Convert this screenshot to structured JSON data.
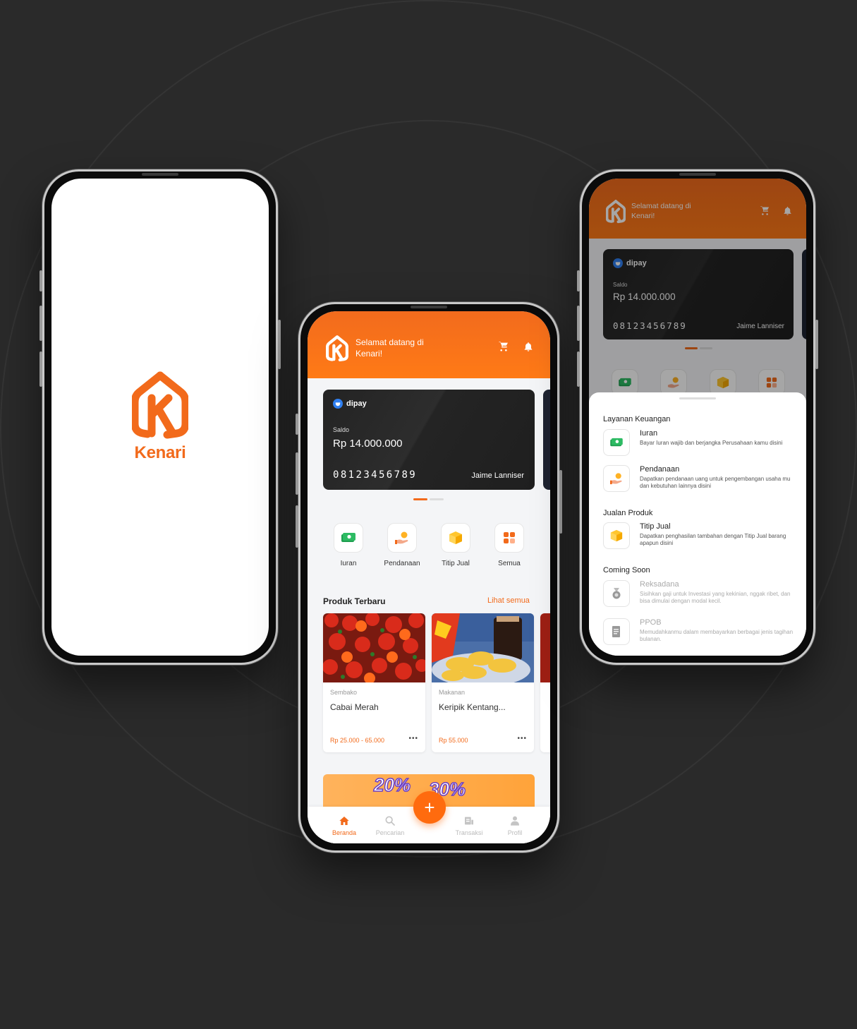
{
  "brand": {
    "name": "Kenari",
    "accent": "#F26A1B"
  },
  "header": {
    "welcome": "Selamat datang di Kenari!",
    "icons": [
      "cart-icon",
      "bell-icon"
    ]
  },
  "wallet": {
    "provider": "dipay",
    "saldo_label": "Saldo",
    "saldo_value": "Rp 14.000.000",
    "card_number": "08123456789",
    "holder": "Jaime Lanniser"
  },
  "menu": [
    {
      "label": "Iuran",
      "icon": "money-icon"
    },
    {
      "label": "Pendanaan",
      "icon": "funding-icon"
    },
    {
      "label": "Titip Jual",
      "icon": "box-icon"
    },
    {
      "label": "Semua",
      "icon": "grid-icon"
    }
  ],
  "products_section": {
    "title": "Produk Terbaru",
    "see_all": "Lihat semua"
  },
  "products": [
    {
      "category": "Sembako",
      "name": "Cabai Merah",
      "price": "Rp 25.000 - 65.000"
    },
    {
      "category": "Makanan",
      "name": "Keripik Kentang...",
      "price": "Rp 55.000"
    }
  ],
  "promo": {
    "texts": [
      "20%",
      "30%"
    ]
  },
  "bottom_nav": [
    {
      "label": "Beranda",
      "icon": "home-icon",
      "active": true
    },
    {
      "label": "Pencarian",
      "icon": "search-icon",
      "active": false
    },
    {
      "label": "Transaksi",
      "icon": "receipt-icon",
      "active": false
    },
    {
      "label": "Profil",
      "icon": "user-icon",
      "active": false
    }
  ],
  "fab": {
    "label": "+"
  },
  "sheet": {
    "sections": [
      {
        "title": "Layanan Keuangan",
        "items": [
          {
            "title": "Iuran",
            "desc": "Bayar Iuran wajib dan berjangka Perusahaan kamu disini"
          },
          {
            "title": "Pendanaan",
            "desc": "Dapatkan pendanaan uang untuk pengembangan usaha mu dan kebutuhan lainnya disini"
          }
        ]
      },
      {
        "title": "Jualan Produk",
        "items": [
          {
            "title": "Titip Jual",
            "desc": "Dapatkan penghasilan tambahan dengan Titip Jual barang apapun disini"
          }
        ]
      },
      {
        "title": "Coming Soon",
        "items": [
          {
            "title": "Reksadana",
            "desc": "Sisihkan gaji untuk Investasi yang kekinian, nggak ribet, dan bisa dimulai dengan modal kecil."
          },
          {
            "title": "PPOB",
            "desc": "Memudahkanmu dalam membayarkan berbagai jenis tagihan bulanan."
          }
        ]
      }
    ]
  }
}
